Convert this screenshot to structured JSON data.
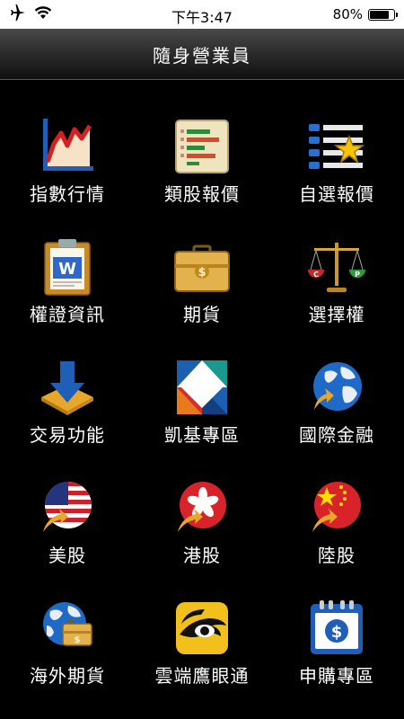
{
  "status_bar": {
    "time": "下午3:47",
    "battery_percent": "80%",
    "battery_level": 0.8
  },
  "nav": {
    "title": "隨身營業員"
  },
  "menu": [
    {
      "label": "指數行情",
      "icon": "index-chart-icon"
    },
    {
      "label": "類股報價",
      "icon": "sector-bars-icon"
    },
    {
      "label": "自選報價",
      "icon": "watchlist-star-icon"
    },
    {
      "label": "權證資訊",
      "icon": "warrant-document-icon"
    },
    {
      "label": "期貨",
      "icon": "futures-briefcase-icon"
    },
    {
      "label": "選擇權",
      "icon": "options-scale-icon"
    },
    {
      "label": "交易功能",
      "icon": "trade-download-icon"
    },
    {
      "label": "凱基專區",
      "icon": "kgi-logo-icon"
    },
    {
      "label": "國際金融",
      "icon": "globe-icon"
    },
    {
      "label": "美股",
      "icon": "us-flag-icon"
    },
    {
      "label": "港股",
      "icon": "hk-flag-icon"
    },
    {
      "label": "陸股",
      "icon": "china-flag-icon"
    },
    {
      "label": "海外期貨",
      "icon": "overseas-futures-icon"
    },
    {
      "label": "雲端鷹眼通",
      "icon": "eagle-eye-icon"
    },
    {
      "label": "申購專區",
      "icon": "subscription-calendar-icon"
    }
  ]
}
